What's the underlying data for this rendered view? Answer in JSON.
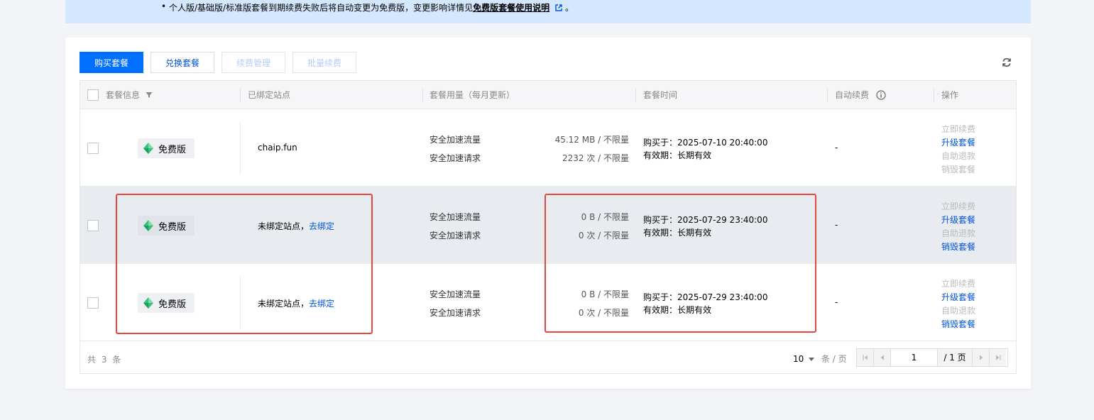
{
  "notice": {
    "bullet": "•",
    "text": "个人版/基础版/标准版套餐到期续费失败后将自动变更为免费版，变更影响详情见",
    "link": "免费版套餐使用说明",
    "end": "。"
  },
  "toolbar": {
    "buy": "购买套餐",
    "redeem": "兑换套餐",
    "renew_manage": "续费管理",
    "batch_renew": "批量续费"
  },
  "table": {
    "headers": {
      "info": "套餐信息",
      "site": "已绑定站点",
      "usage": "套餐用量（每月更新）",
      "time": "套餐时间",
      "auto_renew": "自动续费",
      "ops": "操作"
    },
    "rows": [
      {
        "plan": "免费版",
        "site": "chaip.fun",
        "site_link": "",
        "usage_traffic_label": "安全加速流量",
        "usage_traffic": "45.12 MB / 不限量",
        "usage_req_label": "安全加速请求",
        "usage_req": "2232 次 / 不限量",
        "purchased": "购买于：2025-07-10 20:40:00",
        "validity": "有效期：长期有效",
        "auto_renew": "-",
        "ops": [
          "立即续费",
          "升级套餐",
          "自助退款",
          "销毁套餐"
        ]
      },
      {
        "plan": "免费版",
        "site": "未绑定站点，",
        "site_link": "去绑定",
        "usage_traffic_label": "安全加速流量",
        "usage_traffic": "0 B / 不限量",
        "usage_req_label": "安全加速请求",
        "usage_req": "0 次 / 不限量",
        "purchased": "购买于：2025-07-29 23:40:00",
        "validity": "有效期：长期有效",
        "auto_renew": "-",
        "ops": [
          "立即续费",
          "升级套餐",
          "自助退款",
          "销毁套餐"
        ]
      },
      {
        "plan": "免费版",
        "site": "未绑定站点，",
        "site_link": "去绑定",
        "usage_traffic_label": "安全加速流量",
        "usage_traffic": "0 B / 不限量",
        "usage_req_label": "安全加速请求",
        "usage_req": "0 次 / 不限量",
        "purchased": "购买于：2025-07-29 23:40:00",
        "validity": "有效期：长期有效",
        "auto_renew": "-",
        "ops": [
          "立即续费",
          "升级套餐",
          "自助退款",
          "销毁套餐"
        ]
      }
    ]
  },
  "footer": {
    "total": "共 3 条",
    "page_size": "10",
    "page_size_unit": "条 / 页",
    "current_page": "1",
    "total_pages": "/ 1 页"
  },
  "colors": {
    "primary": "#006eff",
    "link": "#0052d9",
    "highlight": "#e5483f",
    "notice_bg": "#d5e7ff"
  }
}
